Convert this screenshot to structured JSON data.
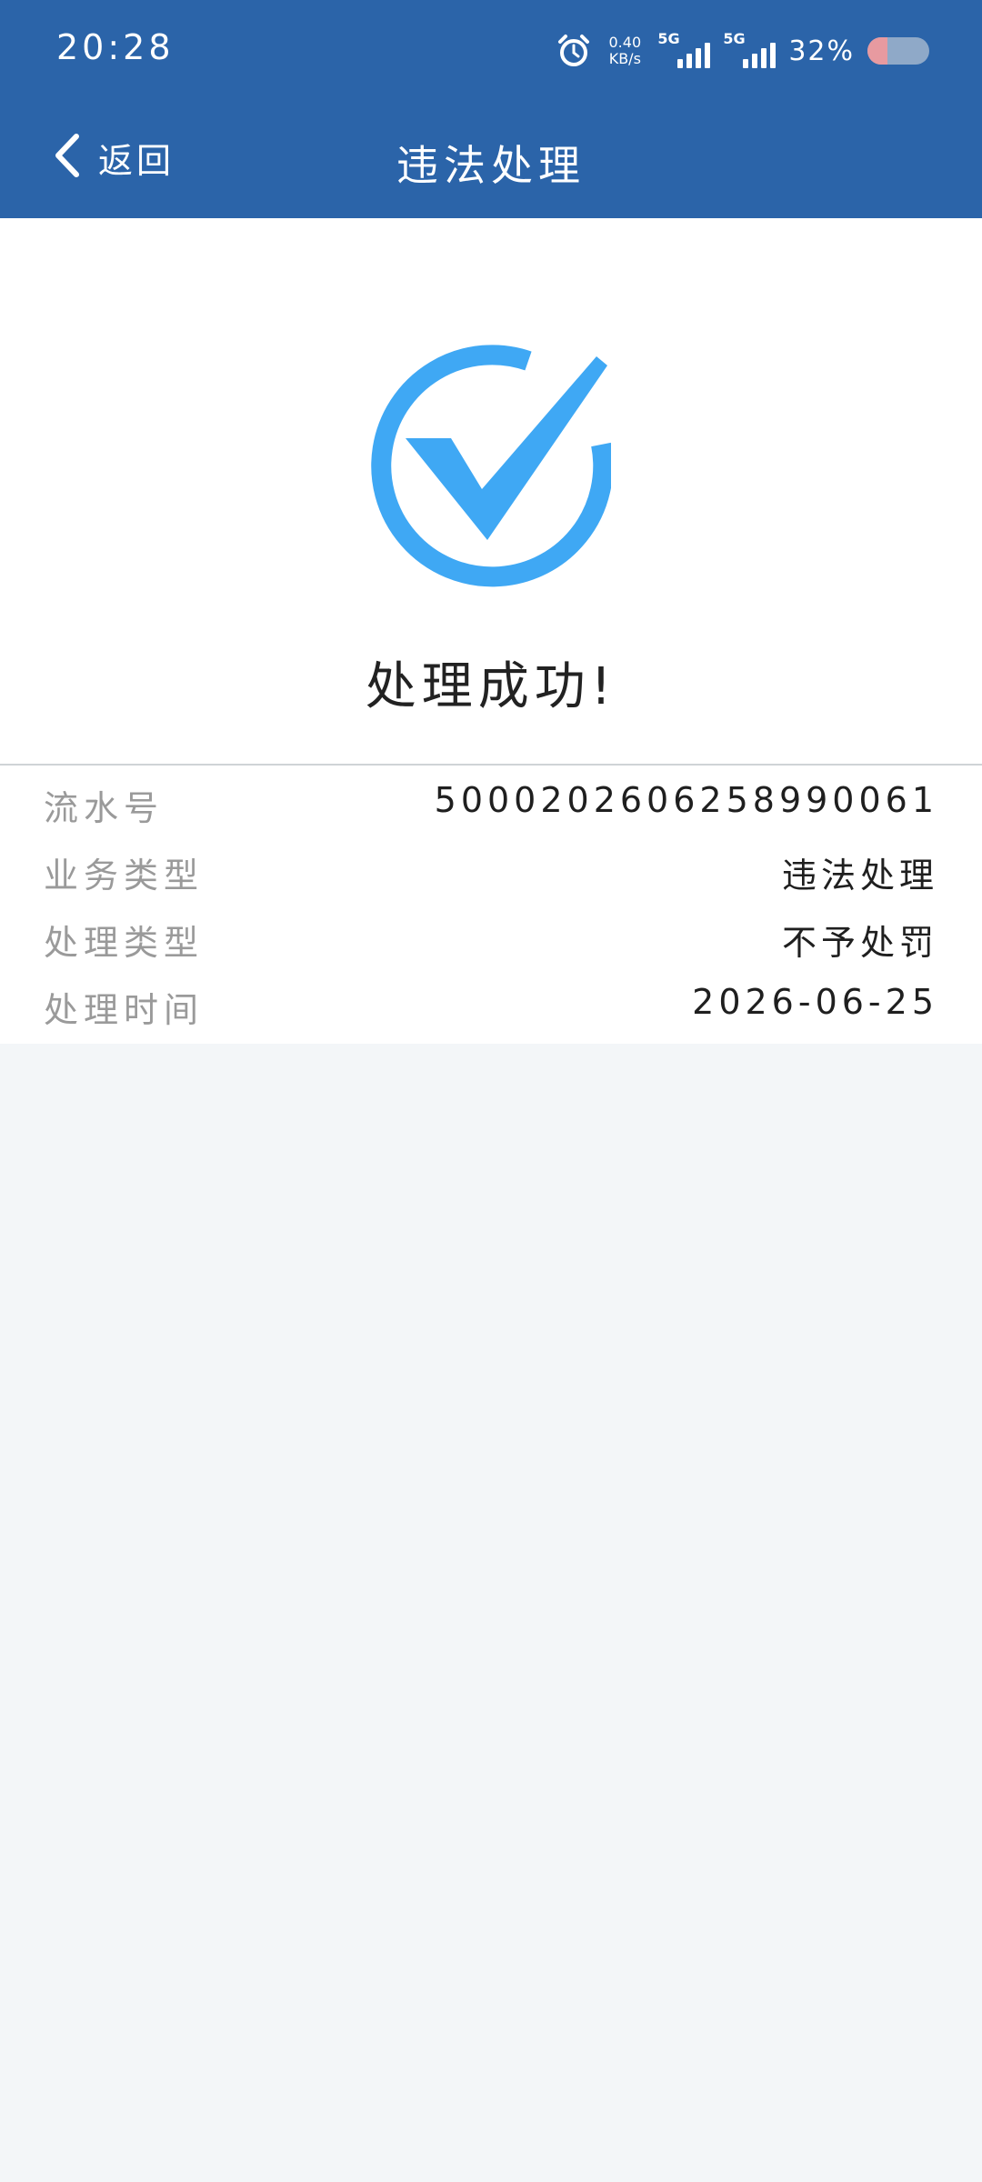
{
  "status_bar": {
    "time": "20:28",
    "net_speed_value": "0.40",
    "net_speed_unit": "KB/s",
    "sim1_label": "5G",
    "sim2_label": "5G",
    "battery_percent": "32%",
    "battery_level": 0.32,
    "alarm_icon": "alarm-clock-icon"
  },
  "nav": {
    "back_label": "返回",
    "title": "违法处理",
    "back_icon": "chevron-left-icon"
  },
  "result": {
    "icon": "check-circle-icon",
    "accent_color": "#3fa8f4",
    "title": "处理成功!"
  },
  "details": [
    {
      "label": "流水号",
      "value": "5000202606258990061"
    },
    {
      "label": "业务类型",
      "value": "违法处理"
    },
    {
      "label": "处理类型",
      "value": "不予处罚"
    },
    {
      "label": "处理时间",
      "value": "2026-06-25"
    }
  ],
  "colors": {
    "header_bg": "#2b64a9",
    "page_bg": "#f3f6f8"
  }
}
